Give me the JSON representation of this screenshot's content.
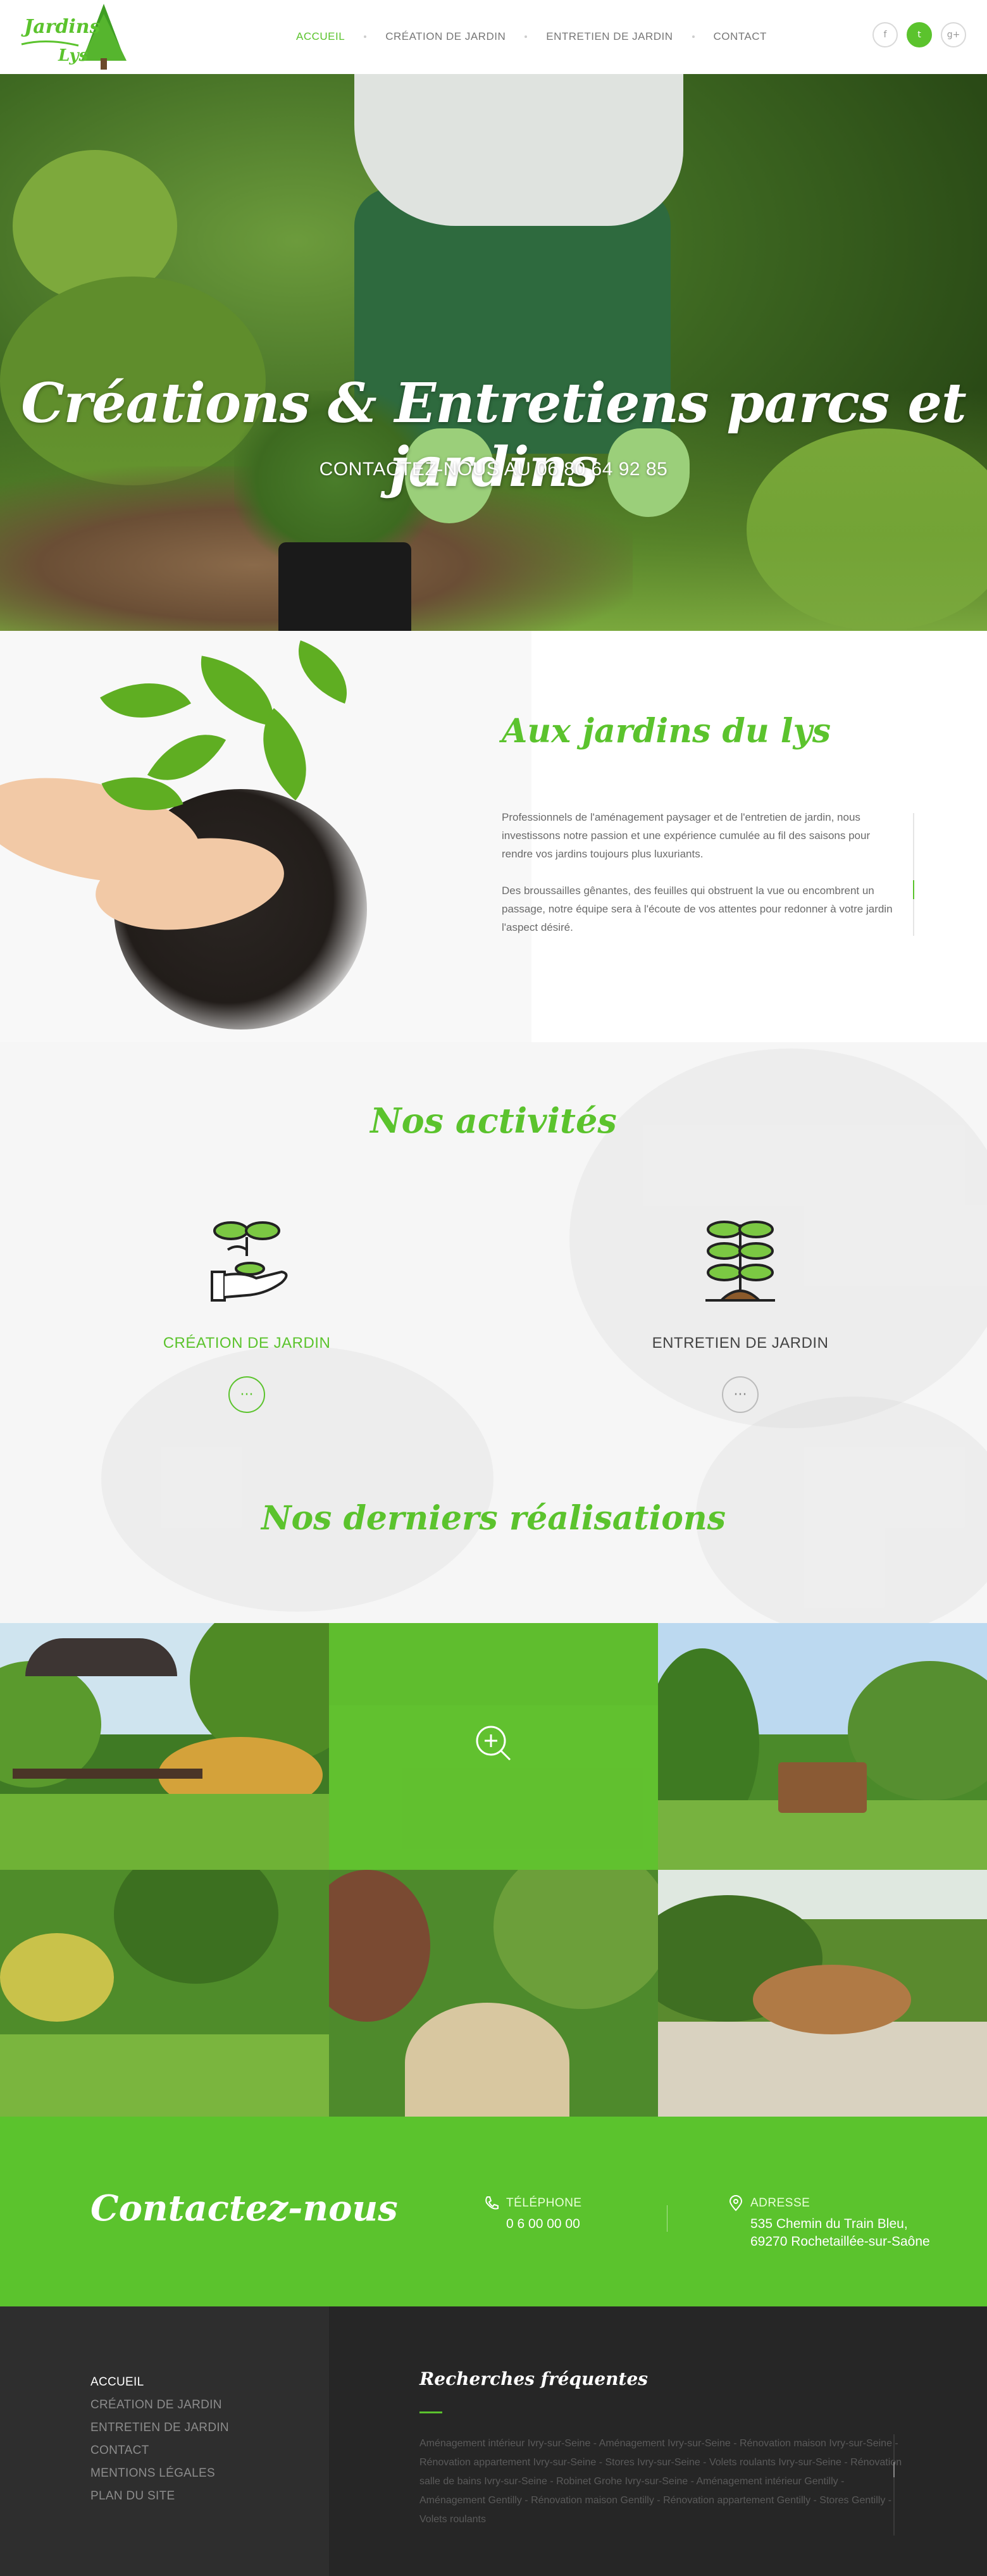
{
  "header": {
    "logo_text": "Aux Jardins du Lys",
    "nav": [
      {
        "label": "ACCUEIL",
        "active": true
      },
      {
        "label": "CRÉATION DE JARDIN",
        "active": false
      },
      {
        "label": "ENTRETIEN DE JARDIN",
        "active": false
      },
      {
        "label": "CONTACT",
        "active": false
      }
    ],
    "social": [
      {
        "icon": "facebook-icon",
        "glyph": "f"
      },
      {
        "icon": "twitter-icon",
        "glyph": "t"
      },
      {
        "icon": "google-plus-icon",
        "glyph": "g+"
      }
    ]
  },
  "hero": {
    "title": "Créations & Entretiens parcs et jardins",
    "subtitle": "CONTACTEZ-NOUS AU 06 80 64 92 85"
  },
  "about": {
    "title": "Aux jardins du lys",
    "paragraphs": [
      "Professionnels de l'aménagement paysager et de l'entretien de jardin, nous investissons notre passion et une expérience cumulée au fil des saisons pour rendre vos jardins toujours plus luxuriants.",
      "Des broussailles gênantes, des feuilles qui obstruent la vue ou encombrent un passage, notre équipe sera à l'écoute de vos attentes pour redonner à votre jardin l'aspect désiré."
    ]
  },
  "activities": {
    "title": "Nos activités",
    "items": [
      {
        "label": "CRÉATION DE JARDIN",
        "more": "···"
      },
      {
        "label": "ENTRETIEN DE JARDIN",
        "more": "···"
      }
    ],
    "realisations_title": "Nos derniers réalisations"
  },
  "contact": {
    "title": "Contactez-nous",
    "phone_label": "TÉLÉPHONE",
    "phone_value": "0 6 00 00 00",
    "address_label": "ADRESSE",
    "address_line1": "535 Chemin du Train Bleu,",
    "address_line2": "69270 Rochetaillée-sur-Saône"
  },
  "footer": {
    "menu": [
      {
        "label": "ACCUEIL",
        "active": true
      },
      {
        "label": "CRÉATION DE JARDIN",
        "active": false
      },
      {
        "label": "ENTRETIEN DE JARDIN",
        "active": false
      },
      {
        "label": "CONTACT",
        "active": false
      },
      {
        "label": "MENTIONS LÉGALES",
        "active": false
      },
      {
        "label": "PLAN DU SITE",
        "active": false
      }
    ],
    "search_title": "Recherches fréquentes",
    "search_links": "Aménagement intérieur Ivry-sur-Seine - Aménagement Ivry-sur-Seine - Rénovation maison Ivry-sur-Seine - Rénovation appartement Ivry-sur-Seine - Stores Ivry-sur-Seine - Volets roulants Ivry-sur-Seine - Rénovation salle de bains Ivry-sur-Seine - Robinet Grohe Ivry-sur-Seine - Aménagement intérieur Gentilly - Aménagement Gentilly - Rénovation maison Gentilly - Rénovation appartement Gentilly - Stores Gentilly - Volets roulants"
  },
  "colors": {
    "brand_green": "#5bc32d",
    "footer_dark": "#262626"
  }
}
